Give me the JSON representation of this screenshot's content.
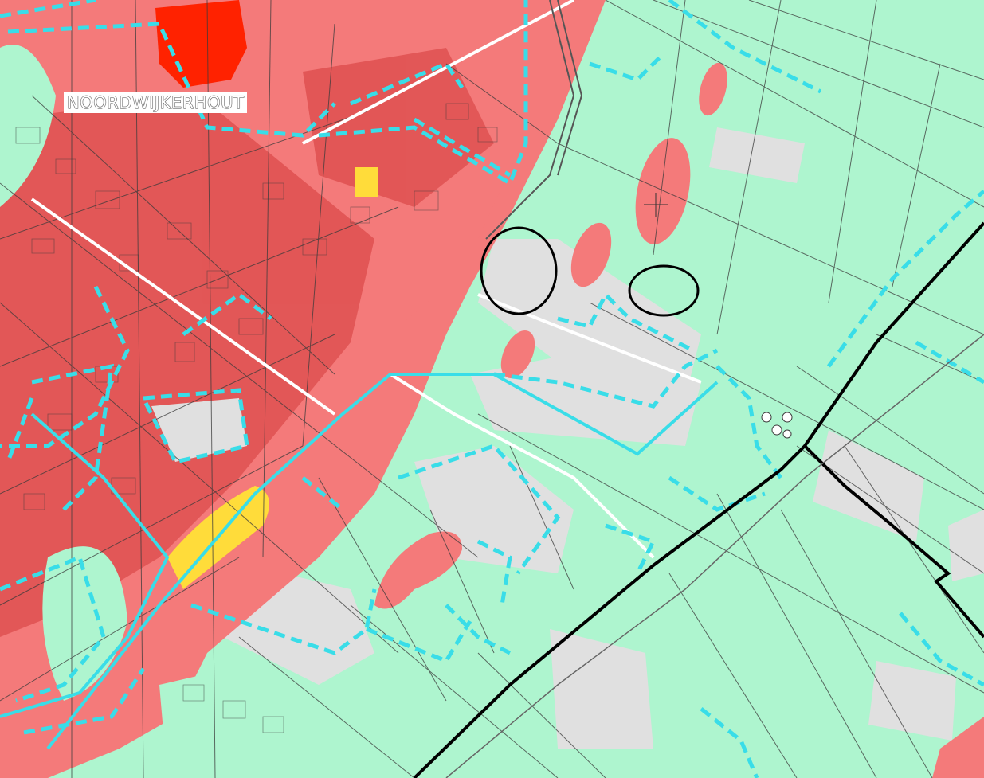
{
  "map": {
    "place_label": "NOORDWIJKERHOUT",
    "colors": {
      "agricultural": "#aef5cf",
      "residential": "#f47a7a",
      "residential_dense": "#d43a3a",
      "urban_core": "#ff2200",
      "commercial": "#ffdc3a",
      "industrial": "#e0e0e0",
      "parcel_lines": "#3a3a3a",
      "boundary_dashed": "#39dde8",
      "municipal_border": "#000000",
      "highlight_circles": "#000000"
    },
    "highlighted_areas": 2,
    "crosshair_marker": true
  }
}
